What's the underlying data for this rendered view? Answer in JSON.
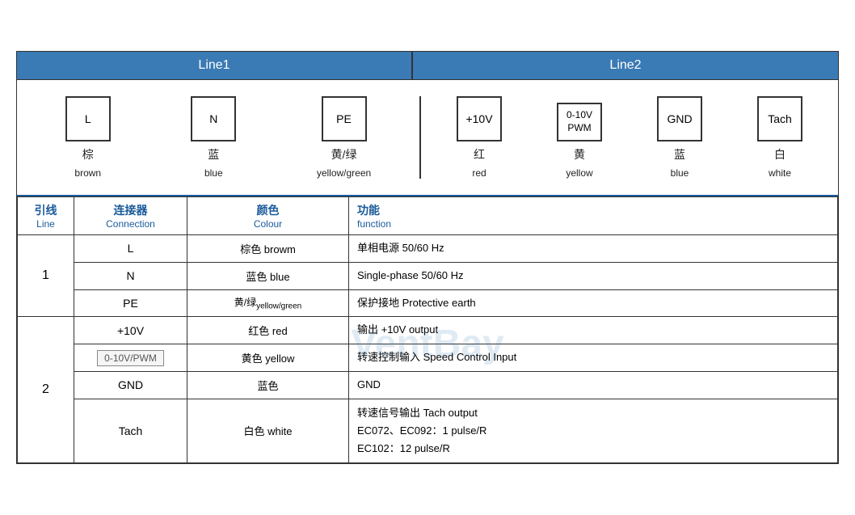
{
  "header": {
    "line1_label": "Line1",
    "line2_label": "Line2"
  },
  "line1_connectors": [
    {
      "id": "l-box",
      "label": "L",
      "cn": "棕",
      "en": "brown"
    },
    {
      "id": "n-box",
      "label": "N",
      "cn": "蓝",
      "en": "blue"
    },
    {
      "id": "pe-box",
      "label": "PE",
      "cn": "黄/绿",
      "en": "yellow/green"
    }
  ],
  "line2_connectors": [
    {
      "id": "10v-box",
      "label": "+10V",
      "cn": "红",
      "en": "red"
    },
    {
      "id": "pwm-box",
      "label": "0-10V\nPWM",
      "cn": "黄",
      "en": "yellow"
    },
    {
      "id": "gnd-box",
      "label": "GND",
      "cn": "蓝",
      "en": "blue"
    },
    {
      "id": "tach-box",
      "label": "Tach",
      "cn": "白",
      "en": "white"
    }
  ],
  "table": {
    "headers": {
      "line_cn": "引线",
      "line_en": "Line",
      "conn_cn": "连接器",
      "conn_en": "Connection",
      "color_cn": "颜色",
      "color_en": "Colour",
      "func_cn": "功能",
      "func_en": "function"
    },
    "rows": [
      {
        "line": "1",
        "sub_rows": [
          {
            "conn": "L",
            "color": "棕色 browm",
            "func": "单相电源 50/60 Hz"
          },
          {
            "conn": "N",
            "color": "蓝色 blue",
            "func": "Single-phase 50/60 Hz"
          },
          {
            "conn": "PE",
            "color": "黄/绿 yellow/green",
            "func": "保护接地 Protective earth"
          }
        ]
      },
      {
        "line": "2",
        "sub_rows": [
          {
            "conn": "+10V",
            "color": "红色 red",
            "func": "输出 +10V output"
          },
          {
            "conn": "0-10V/PWM",
            "color": "黄色 yellow",
            "func": "转速控制输入 Speed Control Input"
          },
          {
            "conn": "GND",
            "color": "蓝色",
            "func": "GND"
          },
          {
            "conn": "Tach",
            "color": "白色 white",
            "func": "转速信号输出 Tach output\nEC072、EC092：1 pulse/R\nEC102：12 pulse/R"
          }
        ]
      }
    ]
  },
  "watermark": "VentBay"
}
